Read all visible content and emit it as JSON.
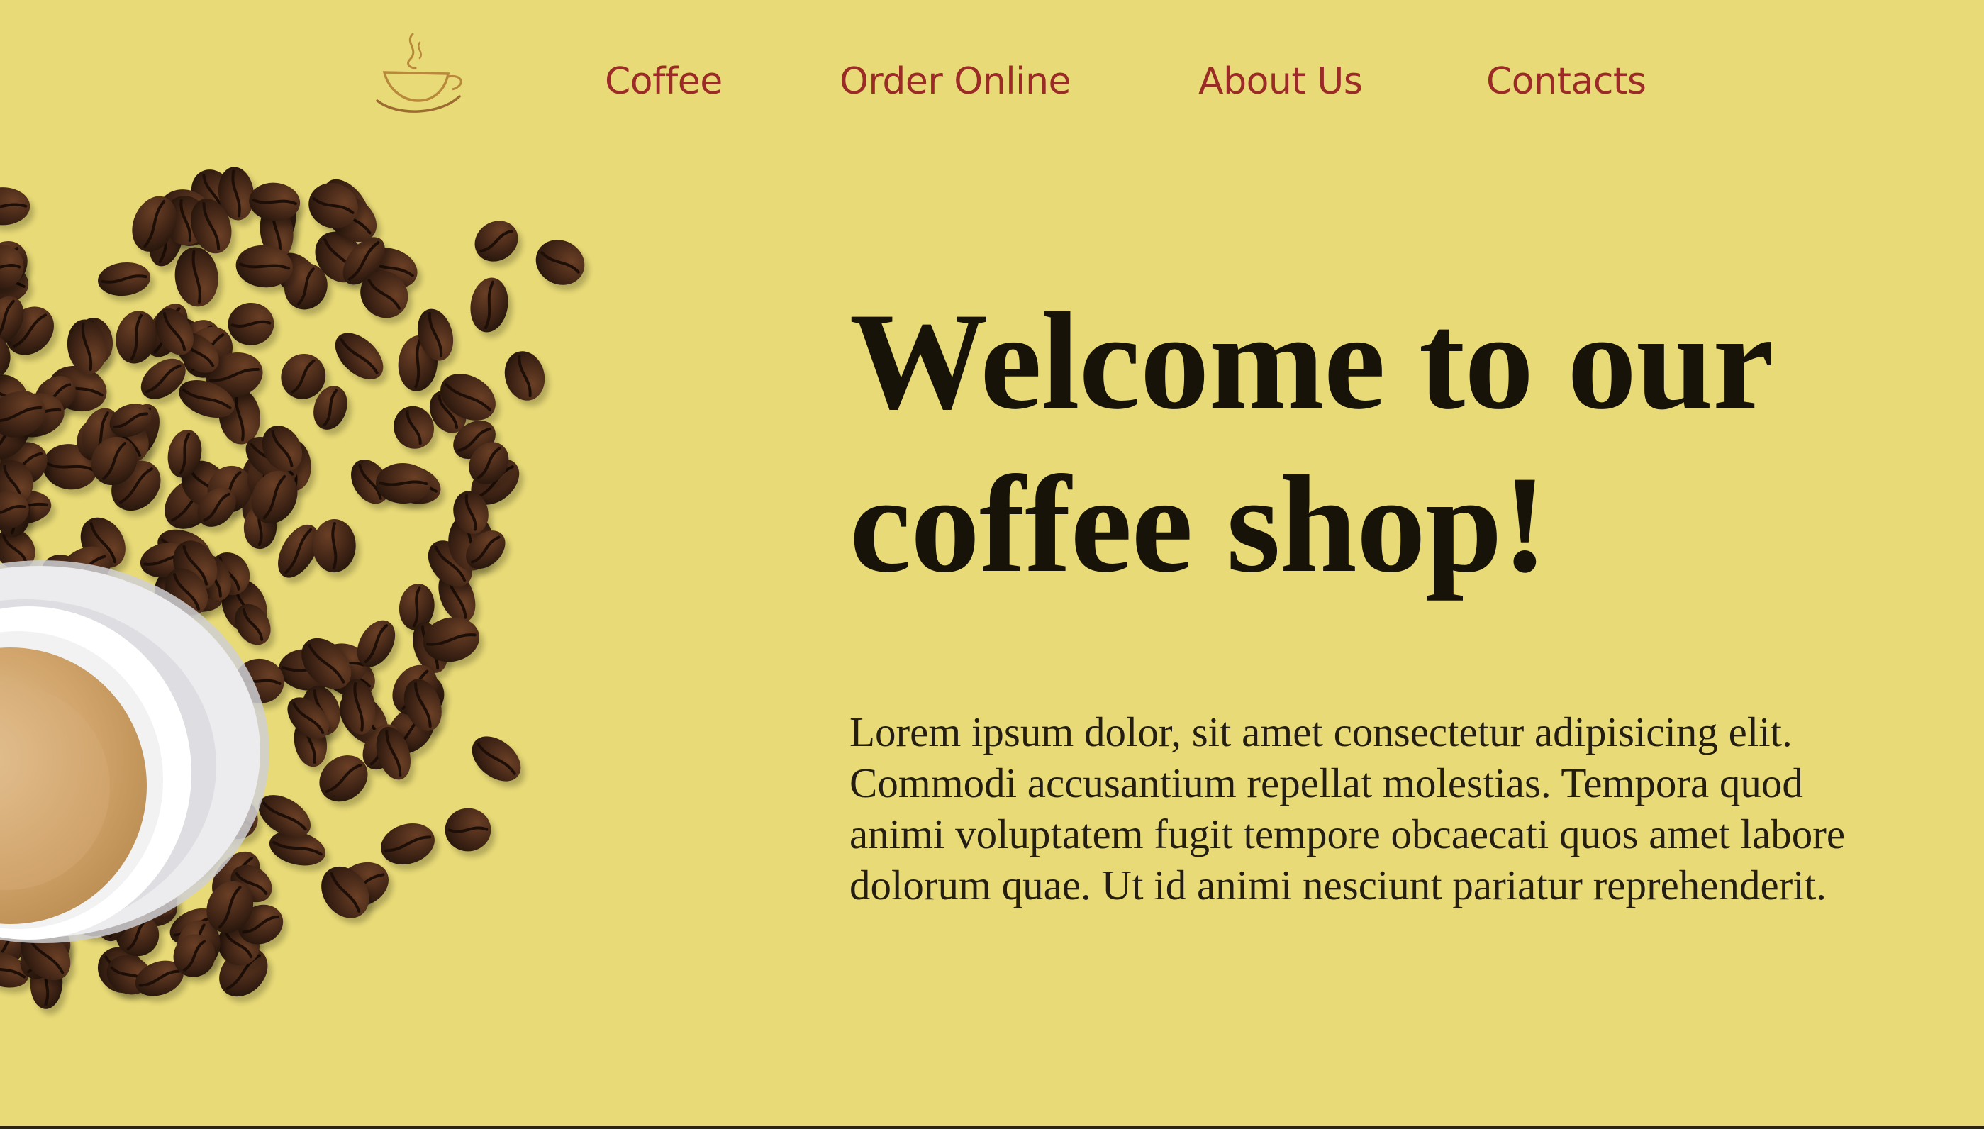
{
  "nav": {
    "logo_icon": "coffee-cup-logo-icon",
    "items": [
      {
        "label": "Coffee"
      },
      {
        "label": "Order Online"
      },
      {
        "label": "About Us"
      },
      {
        "label": "Contacts"
      }
    ]
  },
  "hero": {
    "title": "Welcome to our coffee shop!",
    "body": "Lorem ipsum dolor, sit amet consectetur adipisicing elit. Commodi accusantium repellat molestias. Tempora quod animi voluptatem fugit tempore obcaecati quos amet labore dolorum quae. Ut id animi nesciunt pariatur reprehenderit.",
    "image_icon": "coffee-cup-and-beans-illustration"
  },
  "colors": {
    "background": "#e8da77",
    "nav_link": "#9b2b27",
    "heading": "#171309",
    "body_text": "#231d12",
    "bean": "#4a2a18",
    "saucer": "#dcdcde",
    "crema": "#caa067"
  }
}
